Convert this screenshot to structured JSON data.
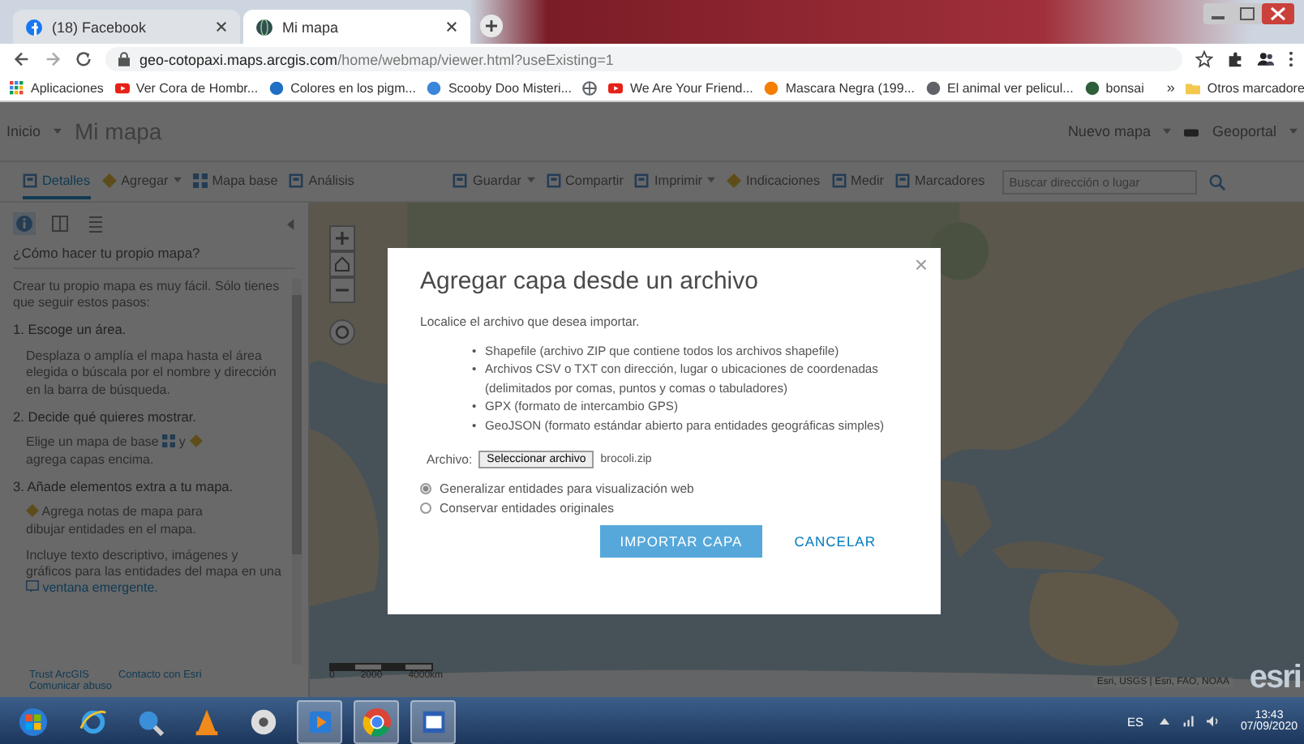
{
  "browser": {
    "tabs": [
      {
        "title": "(18) Facebook",
        "selected": false
      },
      {
        "title": "Mi mapa",
        "selected": true
      }
    ],
    "url": {
      "host": "geo-cotopaxi.maps.arcgis.com",
      "path": "/home/webmap/viewer.html?useExisting=1"
    },
    "bookmarks": [
      {
        "kind": "link",
        "label": "Aplicaciones"
      },
      {
        "kind": "link",
        "label": "Ver Cora de Hombr..."
      },
      {
        "kind": "link",
        "label": "Colores en los pigm..."
      },
      {
        "kind": "link",
        "label": "Scooby Doo Misteri..."
      },
      {
        "kind": "icon"
      },
      {
        "kind": "link",
        "label": "We Are Your Friend..."
      },
      {
        "kind": "link",
        "label": "Mascara Negra (199..."
      },
      {
        "kind": "link",
        "label": "El animal ver pelicul..."
      },
      {
        "kind": "link",
        "label": "bonsai"
      }
    ],
    "more": "»",
    "other_bookmarks": "Otros marcadore"
  },
  "header": {
    "home": "Inicio",
    "title": "Mi mapa",
    "new_map": "Nuevo mapa",
    "account": "Geoportal"
  },
  "toolbar": {
    "items": [
      {
        "label": "Detalles",
        "selected": true,
        "dropdown": false
      },
      {
        "label": "Agregar",
        "selected": false,
        "dropdown": true
      },
      {
        "label": "Mapa base",
        "selected": false,
        "dropdown": false
      },
      {
        "label": "Análisis",
        "selected": false,
        "dropdown": false
      },
      {
        "label": "Guardar",
        "selected": false,
        "dropdown": true
      },
      {
        "label": "Compartir",
        "selected": false,
        "dropdown": false
      },
      {
        "label": "Imprimir",
        "selected": false,
        "dropdown": true
      },
      {
        "label": "Indicaciones",
        "selected": false,
        "dropdown": false
      },
      {
        "label": "Medir",
        "selected": false,
        "dropdown": false
      },
      {
        "label": "Marcadores",
        "selected": false,
        "dropdown": false
      }
    ],
    "search": {
      "placeholder": "Buscar dirección o lugar"
    }
  },
  "sidebar": {
    "tabs": [
      {
        "selected": true
      },
      {
        "selected": false
      },
      {
        "selected": false
      }
    ],
    "title": "¿Cómo hacer tu propio mapa?",
    "intro": "Crear tu propio mapa es muy fácil. Sólo tienes que seguir estos pasos:",
    "steps": [
      {
        "title": "1. Escoge un área.",
        "paragraphs": [
          [
            {
              "kind": "text",
              "text": "Desplaza o amplía el mapa hasta el área elegida o búscala por el nombre y dirección en la barra de búsqueda."
            }
          ]
        ]
      },
      {
        "title": "2. Decide qué quieres mostrar.",
        "paragraphs": [
          [
            {
              "kind": "text",
              "text": "Elige un mapa de base"
            },
            {
              "kind": "grid"
            },
            {
              "kind": "text",
              "text": "y"
            },
            {
              "kind": "plus"
            },
            {
              "kind": "text",
              "text": "agrega capas encima."
            }
          ]
        ]
      },
      {
        "title": "3. Añade elementos extra a tu mapa.",
        "paragraphs": [
          [
            {
              "kind": "plus"
            },
            {
              "kind": "text",
              "text": "Agrega notas de mapa para"
            },
            {
              "kind": "text",
              "text": "dibujar entidades en el mapa."
            }
          ],
          [
            {
              "kind": "text",
              "text": "Incluye texto descriptivo, imágenes y"
            },
            {
              "kind": "text",
              "text": "gráficos para las entidades del mapa"
            },
            {
              "kind": "text",
              "text": "en una"
            },
            {
              "kind": "popup"
            },
            {
              "kind": "link",
              "text": "ventana emergente."
            }
          ]
        ]
      }
    ],
    "footer": [
      "Trust ArcGIS",
      "Contacto con Esri",
      "Comunicar abuso"
    ]
  },
  "map": {
    "kind": "picture",
    "scale": [
      "0",
      "2000",
      "4000km"
    ],
    "attribution": "Esri, USGS | Esri, FAO, NOAA",
    "logo": "esri"
  },
  "dialog": {
    "title": "Agregar capa desde un archivo",
    "close": "×",
    "intro": "Localice el archivo que desea importar.",
    "bullet": "•",
    "formats": [
      "Shapefile (archivo ZIP que contiene todos los archivos shapefile)",
      "Archivos CSV o TXT con dirección, lugar o ubicaciones de coordenadas (delimitados por comas, puntos y comas o tabuladores)",
      "GPX (formato de intercambio GPS)",
      "GeoJSON (formato estándar abierto para entidades geográficas simples)"
    ],
    "file_label": "Archivo:",
    "file_button": "Seleccionar archivo",
    "file_name": "brocoli.zip",
    "options": [
      {
        "label": "Generalizar entidades para visualización web",
        "selected": true
      },
      {
        "label": "Conservar entidades originales",
        "selected": false
      }
    ],
    "import": "IMPORTAR CAPA",
    "cancel": "CANCELAR"
  },
  "taskbar": {
    "apps": [
      {
        "selected": false
      },
      {
        "selected": false
      },
      {
        "selected": false
      },
      {
        "selected": false
      },
      {
        "selected": false
      },
      {
        "selected": true
      },
      {
        "selected": true
      },
      {
        "selected": true
      }
    ],
    "language": "ES",
    "time": "13:43",
    "date": "07/09/2020"
  }
}
